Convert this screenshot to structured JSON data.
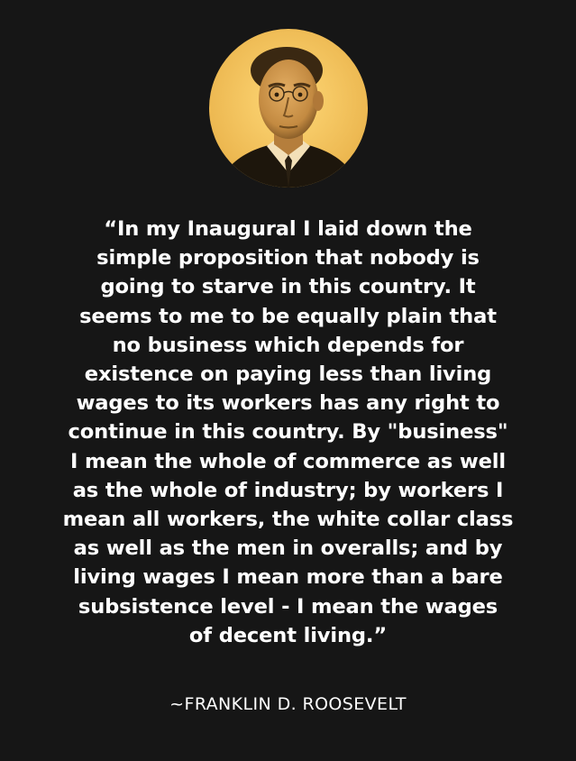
{
  "portrait": {
    "subject": "Franklin D. Roosevelt",
    "tone_colors": {
      "background": "#f2c25a",
      "background_glow": "#ffd978",
      "suit": "#1d160c",
      "skin": "#d39a4e",
      "shadow": "#6e4a1c"
    }
  },
  "quote": {
    "lines": [
      "“In my Inaugural I laid down the",
      "simple proposition that nobody is",
      "going to starve in this country. It",
      "seems to me to be equally plain that",
      "no business which depends for",
      "existence on paying less than living",
      "wages to its workers has any right to",
      "continue in this country. By \"business\"",
      "I mean the whole of commerce as well",
      "as the whole of industry; by workers I",
      "mean all workers, the white collar class",
      "as well as the men in overalls; and by",
      "living wages I mean more than a bare",
      "subsistence level - I mean the wages",
      "of decent living.”"
    ]
  },
  "attribution": {
    "text": "~FRANKLIN D. ROOSEVELT"
  },
  "colors": {
    "page_background": "#161616",
    "text": "#ffffff"
  }
}
